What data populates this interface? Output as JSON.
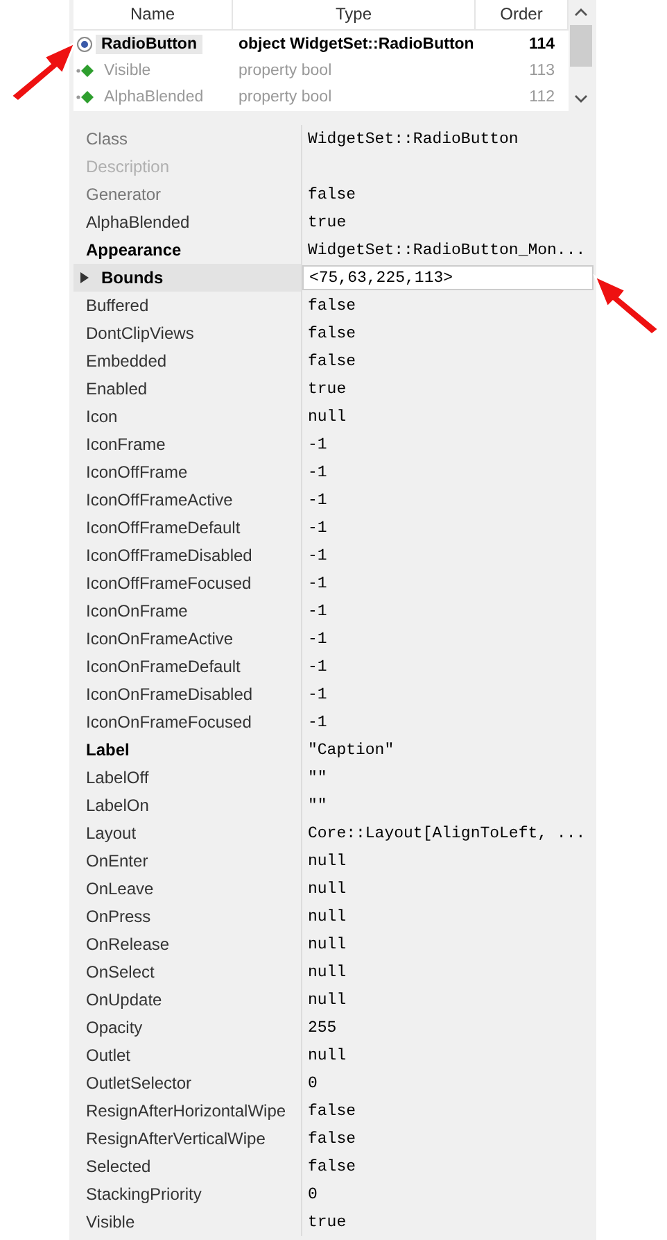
{
  "tree": {
    "columns": [
      "Name",
      "Type",
      "Order"
    ],
    "rows": [
      {
        "name": "RadioButton",
        "type": "object WidgetSet::RadioButton",
        "order": "114",
        "kind": "object",
        "selected": true
      },
      {
        "name": "Visible",
        "type": "property bool",
        "order": "113",
        "kind": "property",
        "selected": false
      },
      {
        "name": "AlphaBlended",
        "type": "property bool",
        "order": "112",
        "kind": "property",
        "selected": false
      }
    ]
  },
  "properties": [
    {
      "name": "Class",
      "value": "WidgetSet::RadioButton",
      "kind": "readonly"
    },
    {
      "name": "Description",
      "kind": "disabled"
    },
    {
      "name": "Generator",
      "value": "false",
      "kind": "readonly"
    },
    {
      "name": "AlphaBlended",
      "value": "true",
      "kind": "normal"
    },
    {
      "name": "Appearance",
      "value": "WidgetSet::RadioButton_Mon...",
      "kind": "bold"
    },
    {
      "name": "Bounds",
      "value": "<75,63,225,113>",
      "kind": "bold",
      "expandable": true,
      "editing": true
    },
    {
      "name": "Buffered",
      "value": "false",
      "kind": "normal"
    },
    {
      "name": "DontClipViews",
      "value": "false",
      "kind": "normal"
    },
    {
      "name": "Embedded",
      "value": "false",
      "kind": "normal"
    },
    {
      "name": "Enabled",
      "value": "true",
      "kind": "normal"
    },
    {
      "name": "Icon",
      "value": "null",
      "kind": "normal"
    },
    {
      "name": "IconFrame",
      "value": "-1",
      "kind": "normal"
    },
    {
      "name": "IconOffFrame",
      "value": "-1",
      "kind": "normal"
    },
    {
      "name": "IconOffFrameActive",
      "value": "-1",
      "kind": "normal"
    },
    {
      "name": "IconOffFrameDefault",
      "value": "-1",
      "kind": "normal"
    },
    {
      "name": "IconOffFrameDisabled",
      "value": "-1",
      "kind": "normal"
    },
    {
      "name": "IconOffFrameFocused",
      "value": "-1",
      "kind": "normal"
    },
    {
      "name": "IconOnFrame",
      "value": "-1",
      "kind": "normal"
    },
    {
      "name": "IconOnFrameActive",
      "value": "-1",
      "kind": "normal"
    },
    {
      "name": "IconOnFrameDefault",
      "value": "-1",
      "kind": "normal"
    },
    {
      "name": "IconOnFrameDisabled",
      "value": "-1",
      "kind": "normal"
    },
    {
      "name": "IconOnFrameFocused",
      "value": "-1",
      "kind": "normal"
    },
    {
      "name": "Label",
      "value": "\"Caption\"",
      "kind": "bold"
    },
    {
      "name": "LabelOff",
      "value": "\"\"",
      "kind": "normal"
    },
    {
      "name": "LabelOn",
      "value": "\"\"",
      "kind": "normal"
    },
    {
      "name": "Layout",
      "value": "Core::Layout[AlignToLeft, ...",
      "kind": "normal"
    },
    {
      "name": "OnEnter",
      "value": "null",
      "kind": "normal"
    },
    {
      "name": "OnLeave",
      "value": "null",
      "kind": "normal"
    },
    {
      "name": "OnPress",
      "value": "null",
      "kind": "normal"
    },
    {
      "name": "OnRelease",
      "value": "null",
      "kind": "normal"
    },
    {
      "name": "OnSelect",
      "value": "null",
      "kind": "normal"
    },
    {
      "name": "OnUpdate",
      "value": "null",
      "kind": "normal"
    },
    {
      "name": "Opacity",
      "value": "255",
      "kind": "normal"
    },
    {
      "name": "Outlet",
      "value": "null",
      "kind": "normal"
    },
    {
      "name": "OutletSelector",
      "value": "0",
      "kind": "normal"
    },
    {
      "name": "ResignAfterHorizontalWipe",
      "value": "false",
      "kind": "normal"
    },
    {
      "name": "ResignAfterVerticalWipe",
      "value": "false",
      "kind": "normal"
    },
    {
      "name": "Selected",
      "value": "false",
      "kind": "normal"
    },
    {
      "name": "StackingPriority",
      "value": "0",
      "kind": "normal"
    },
    {
      "name": "Visible",
      "value": "true",
      "kind": "normal"
    }
  ]
}
